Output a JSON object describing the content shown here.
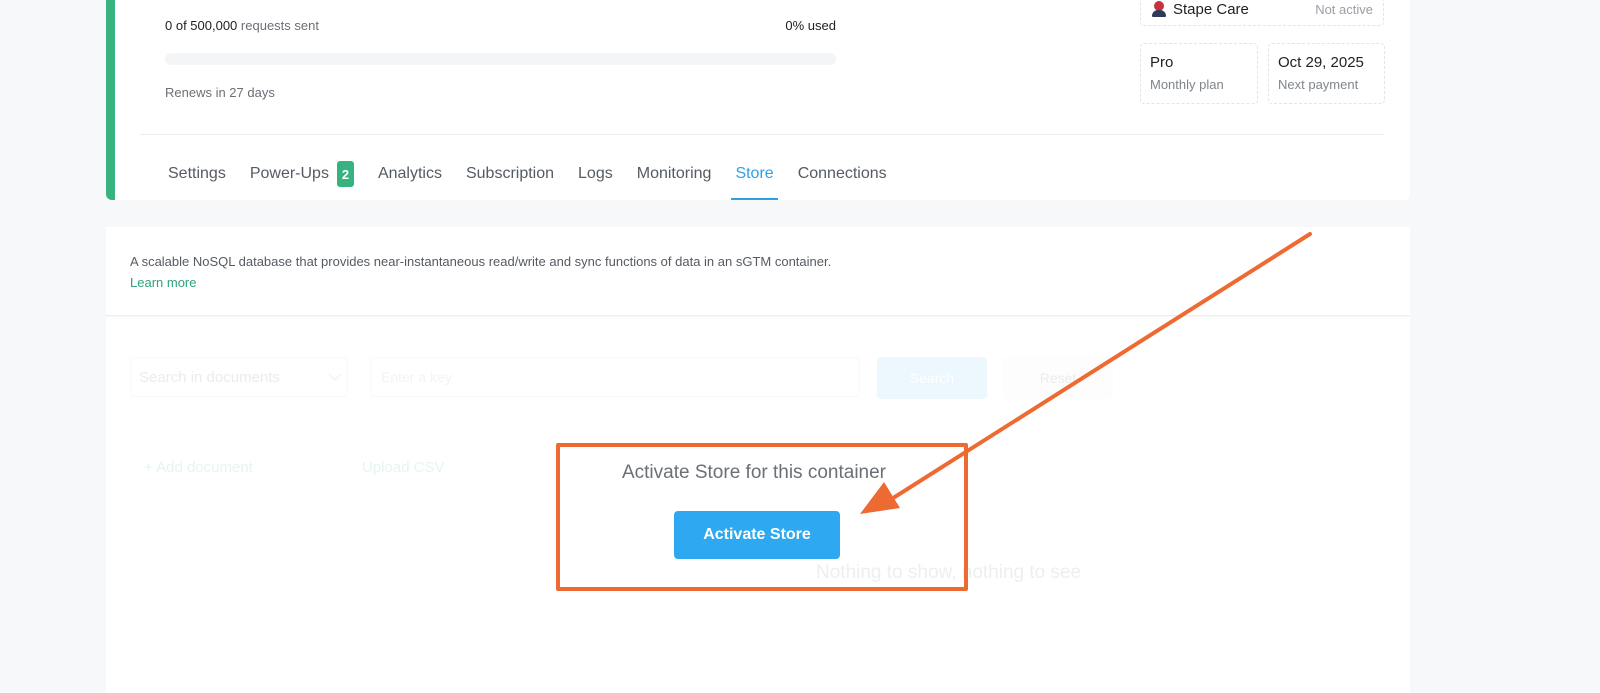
{
  "usage": {
    "count": "0 of 500,000",
    "label": "requests sent",
    "used": "0% used",
    "progress_fraction": 0,
    "renews": "Renews in 27 days"
  },
  "care": {
    "name": "Stape Care",
    "status": "Not active"
  },
  "plan": {
    "name": "Pro",
    "cycle": "Monthly plan"
  },
  "payment": {
    "date": "Oct 29, 2025",
    "label": "Next payment"
  },
  "tabs": [
    {
      "label": "Settings"
    },
    {
      "label": "Power-Ups",
      "badge": "2"
    },
    {
      "label": "Analytics"
    },
    {
      "label": "Subscription"
    },
    {
      "label": "Logs"
    },
    {
      "label": "Monitoring"
    },
    {
      "label": "Store",
      "active": true
    },
    {
      "label": "Connections"
    }
  ],
  "description": {
    "text": "A scalable NoSQL database that provides near-instantaneous read/write and sync functions of data in an sGTM container.",
    "link": "Learn more"
  },
  "store": {
    "search_select": "Search in documents",
    "key_placeholder": "Enter a key",
    "search_button": "Search",
    "reset_button": "Reset",
    "add_document": "+ Add document",
    "upload_csv": "Upload CSV",
    "empty": "Nothing to show, nothing to see",
    "activate_title": "Activate Store for this container",
    "activate_button": "Activate Store"
  },
  "colors": {
    "accent_green": "#36b37e",
    "link_blue": "#2ea1e6",
    "annotation_orange": "#ee6a33"
  }
}
